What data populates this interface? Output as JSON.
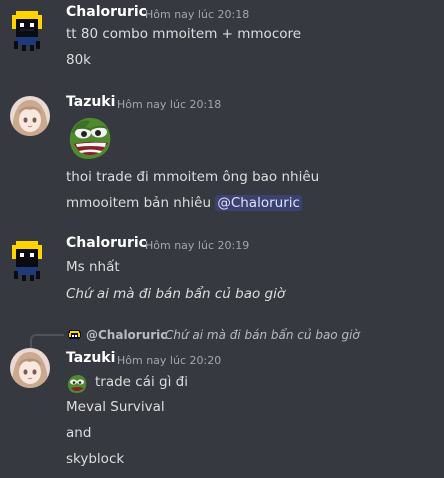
{
  "messages": [
    {
      "author": "Chaloruric",
      "timestamp": "Hôm nay lúc 20:18",
      "lines": [
        "tt 80 combo mmoitem + mmocore",
        "80k"
      ]
    },
    {
      "author": "Tazuki",
      "timestamp": "Hôm nay lúc 20:18",
      "emoji": "pepe-emoji",
      "lines": [
        "thoi trade đi mmoitem ông bao nhiêu",
        "mmooitem bản nhiêu "
      ],
      "mention": "@Chaloruric"
    },
    {
      "author": "Chaloruric",
      "timestamp": "Hôm nay lúc 20:19",
      "lines": [
        "Ms nhất",
        "Chứ ai mà đi bán bẩn củ bao giờ"
      ]
    },
    {
      "reply": {
        "author": "@Chaloruric",
        "text": "Chứ ai mà đi bán bẩn củ bao giờ"
      },
      "author": "Tazuki",
      "timestamp": "Hôm nay lúc 20:20",
      "lines": [
        "trade cái gì đi",
        "Meval Survival",
        "and",
        "skyblock"
      ]
    }
  ],
  "colors": {
    "background": "#36393f",
    "mention_bg": "#3c4270",
    "mention_text": "#dee0fc",
    "timestamp": "#a3a6aa"
  }
}
